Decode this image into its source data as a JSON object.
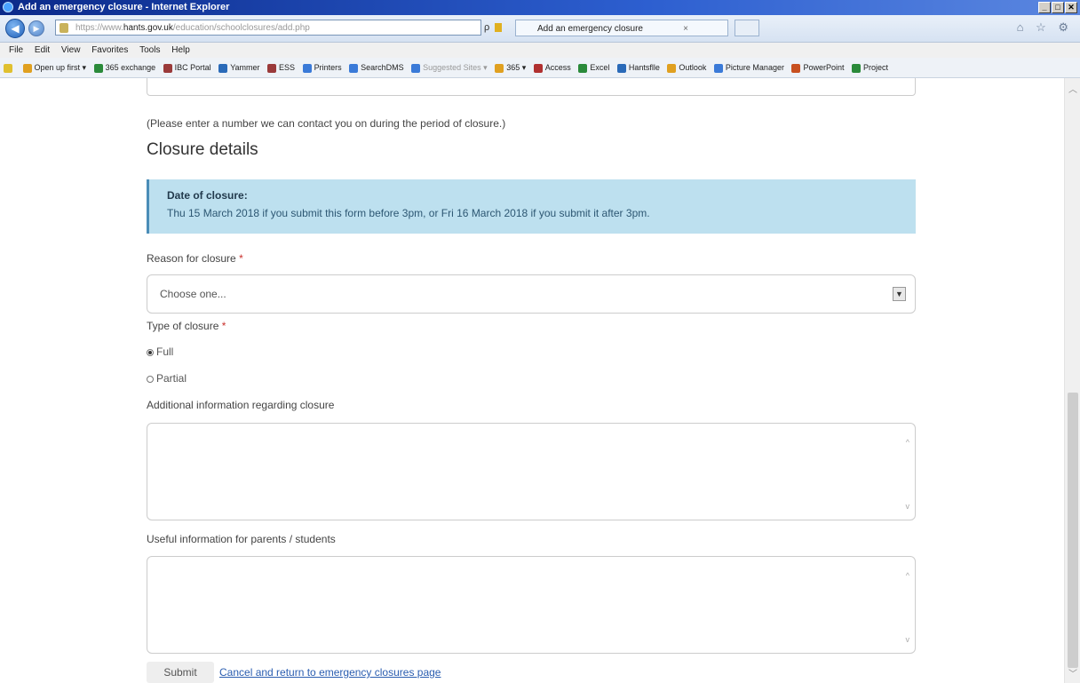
{
  "window": {
    "title": "Add an emergency closure - Internet Explorer",
    "controls": [
      "_",
      "□",
      "✕"
    ]
  },
  "browser": {
    "address_prefix": "https://www.",
    "address_domain": "hants.gov.uk",
    "address_path": "/education/schoolclosures/add.php",
    "search_glyph": "ρ",
    "tab_title": "Add an emergency closure",
    "tab_close": "×",
    "nav_icons": "⌂ ☆ ⚙"
  },
  "menu": [
    "File",
    "Edit",
    "View",
    "Favorites",
    "Tools",
    "Help"
  ],
  "favorites": [
    {
      "label": "Open up first ▾",
      "color": "#e0a020"
    },
    {
      "label": "365 exchange",
      "color": "#2a8a3a"
    },
    {
      "label": "IBC Portal",
      "color": "#9a3a3a"
    },
    {
      "label": "Yammer",
      "color": "#2a6ab8"
    },
    {
      "label": "ESS",
      "color": "#9a3a3a"
    },
    {
      "label": "Printers",
      "color": "#3a7ad8"
    },
    {
      "label": "SearchDMS",
      "color": "#3a7ad8"
    },
    {
      "label": "Suggested Sites ▾",
      "color": "#3a7ad8"
    },
    {
      "label": "365 ▾",
      "color": "#e0a020"
    },
    {
      "label": "Access",
      "color": "#b03030"
    },
    {
      "label": "Excel",
      "color": "#2a8a3a"
    },
    {
      "label": "Hantsflle",
      "color": "#2a6ab8"
    },
    {
      "label": "Outlook",
      "color": "#e0a020"
    },
    {
      "label": "Picture Manager",
      "color": "#3a7ad8"
    },
    {
      "label": "PowerPoint",
      "color": "#c85020"
    },
    {
      "label": "Project",
      "color": "#2a8a3a"
    }
  ],
  "form": {
    "phone_help": "(Please enter a number we can contact you on during the period of closure.)",
    "section_title": "Closure details",
    "alert_title": "Date of closure:",
    "alert_text": "Thu 15 March 2018 if you submit this form before 3pm, or Fri 16 March 2018 if you submit it after 3pm.",
    "reason_label": "Reason for closure",
    "required_mark": "*",
    "reason_value": "Choose one...",
    "type_label": "Type of closure",
    "type_options": [
      "Full",
      "Partial"
    ],
    "additional_label": "Additional information regarding closure",
    "parents_label": "Useful information for parents / students",
    "submit_label": "Submit",
    "cancel_label": "Cancel and return to emergency closures page"
  }
}
